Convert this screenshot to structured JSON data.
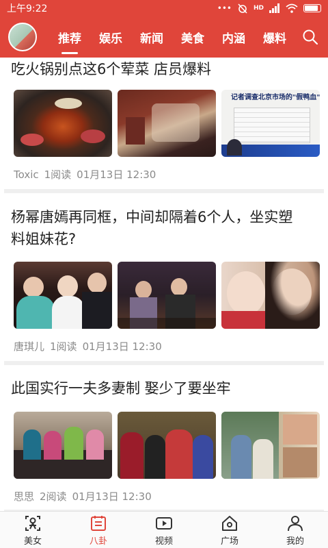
{
  "status_bar": {
    "time": "上午9:22",
    "network": "HD"
  },
  "top_nav": {
    "tabs": [
      {
        "label": "推荐",
        "active": true
      },
      {
        "label": "娱乐"
      },
      {
        "label": "新闻"
      },
      {
        "label": "美食"
      },
      {
        "label": "内涵"
      },
      {
        "label": "爆料"
      }
    ]
  },
  "feed": {
    "articles": [
      {
        "title": "吃火锅别点这6个荤菜 店员爆料",
        "author": "Toxic",
        "reads": "1阅读",
        "date": "01月13日 12:30",
        "thumb_caption": "记者调查北京市场的\"假鸭血\""
      },
      {
        "title": "杨幂唐嫣再同框，中间却隔着6个人，坐实塑料姐妹花?",
        "author": "唐琪儿",
        "reads": "1阅读",
        "date": "01月13日 12:30"
      },
      {
        "title": "此国实行一夫多妻制 娶少了要坐牢",
        "author": "思思",
        "reads": "2阅读",
        "date": "01月13日 12:30"
      }
    ]
  },
  "bottom_nav": {
    "items": [
      {
        "label": "美女",
        "icon": "beauty-icon"
      },
      {
        "label": "八卦",
        "icon": "gossip-icon",
        "active": true
      },
      {
        "label": "视频",
        "icon": "video-icon"
      },
      {
        "label": "广场",
        "icon": "plaza-icon"
      },
      {
        "label": "我的",
        "icon": "profile-icon"
      }
    ]
  },
  "colors": {
    "brand": "#e0453a",
    "meta_text": "#8a8a8a"
  }
}
